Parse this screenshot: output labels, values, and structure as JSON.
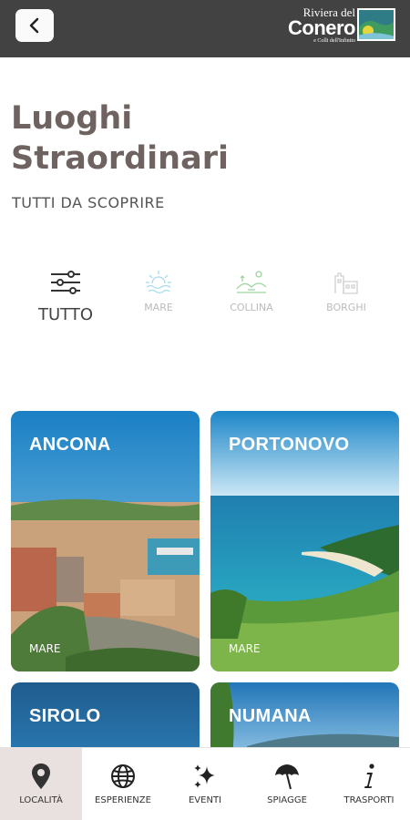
{
  "header": {
    "back_icon": "chevron-left-icon",
    "brand": {
      "line1": "Riviera del",
      "line2": "Conero",
      "line3": "e Colli dell'Infinito"
    }
  },
  "title": {
    "line1": "Luoghi",
    "line2": "Straordinari"
  },
  "subtitle": "TUTTI DA SCOPRIRE",
  "filters": [
    {
      "label": "TUTTO",
      "icon": "sliders-icon",
      "active": true
    },
    {
      "label": "MARE",
      "icon": "sun-sea-icon",
      "active": false
    },
    {
      "label": "COLLINA",
      "icon": "hills-icon",
      "active": false
    },
    {
      "label": "BORGHI",
      "icon": "castle-icon",
      "active": false
    }
  ],
  "cards": [
    {
      "name": "ANCONA",
      "tag": "MARE"
    },
    {
      "name": "PORTONOVO",
      "tag": "MARE"
    },
    {
      "name": "SIROLO",
      "tag": ""
    },
    {
      "name": "NUMANA",
      "tag": ""
    }
  ],
  "tabs": [
    {
      "label": "LOCALITÀ",
      "icon": "map-pin-icon",
      "active": true
    },
    {
      "label": "ESPERIENZE",
      "icon": "globe-icon",
      "active": false
    },
    {
      "label": "EVENTI",
      "icon": "sparkles-icon",
      "active": false
    },
    {
      "label": "SPIAGGE",
      "icon": "umbrella-icon",
      "active": false
    },
    {
      "label": "TRASPORTI",
      "icon": "info-icon",
      "active": false
    }
  ],
  "colors": {
    "topbar": "#424242",
    "title": "#6e6360",
    "active_tab": "#e9e1df",
    "filter_icon": "#9ed6a0"
  }
}
